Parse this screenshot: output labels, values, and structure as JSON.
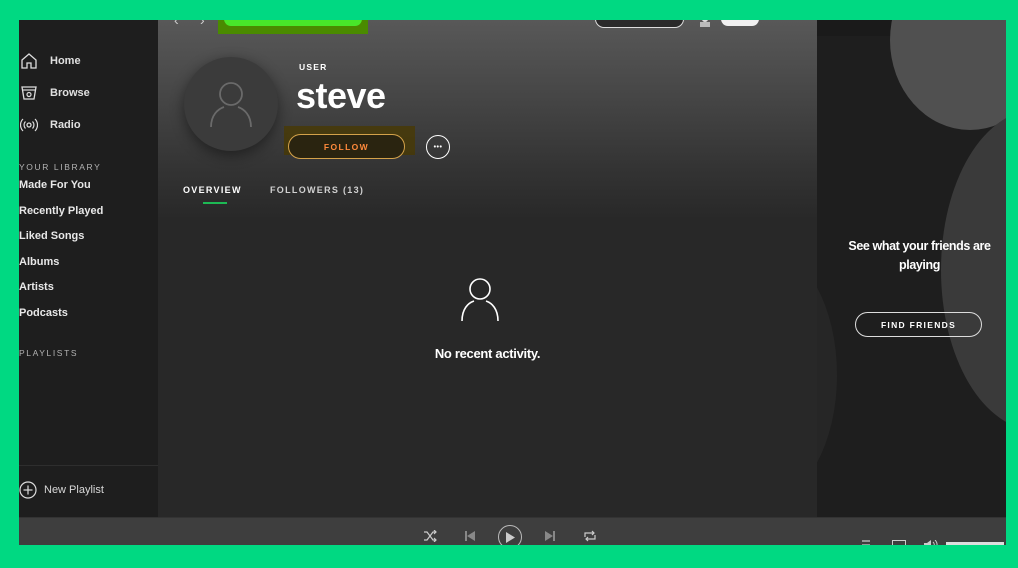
{
  "sidebar": {
    "nav": [
      {
        "label": "Home",
        "icon": "home-icon"
      },
      {
        "label": "Browse",
        "icon": "browse-icon"
      },
      {
        "label": "Radio",
        "icon": "radio-icon"
      }
    ],
    "library_heading": "YOUR LIBRARY",
    "library": [
      "Made For You",
      "Recently Played",
      "Liked Songs",
      "Albums",
      "Artists",
      "Podcasts"
    ],
    "playlists_heading": "PLAYLISTS",
    "new_playlist": "New Playlist"
  },
  "topbar": {
    "back_glyph": "‹",
    "forward_glyph": "›",
    "menu_glyph": "⌄",
    "search_placeholder": ""
  },
  "profile": {
    "type_label": "USER",
    "name": "steve",
    "follow_label": "FOLLOW",
    "more_label": "•••",
    "follow_color": "#ff8a3c"
  },
  "tabs": [
    {
      "label": "OVERVIEW",
      "active": true
    },
    {
      "label": "FOLLOWERS (13)",
      "active": false
    }
  ],
  "empty_state": {
    "message": "No recent activity."
  },
  "friends_panel": {
    "message": "See what your friends are playing",
    "button": "FIND FRIENDS"
  },
  "player": {
    "controls": [
      "shuffle",
      "previous",
      "play",
      "next",
      "repeat"
    ],
    "right_controls": [
      "queue",
      "devices",
      "volume"
    ]
  },
  "colors": {
    "accent": "#1db954",
    "frame": "#00d982",
    "sidebar_bg": "#1e1e1e",
    "main_bg": "#282828"
  }
}
